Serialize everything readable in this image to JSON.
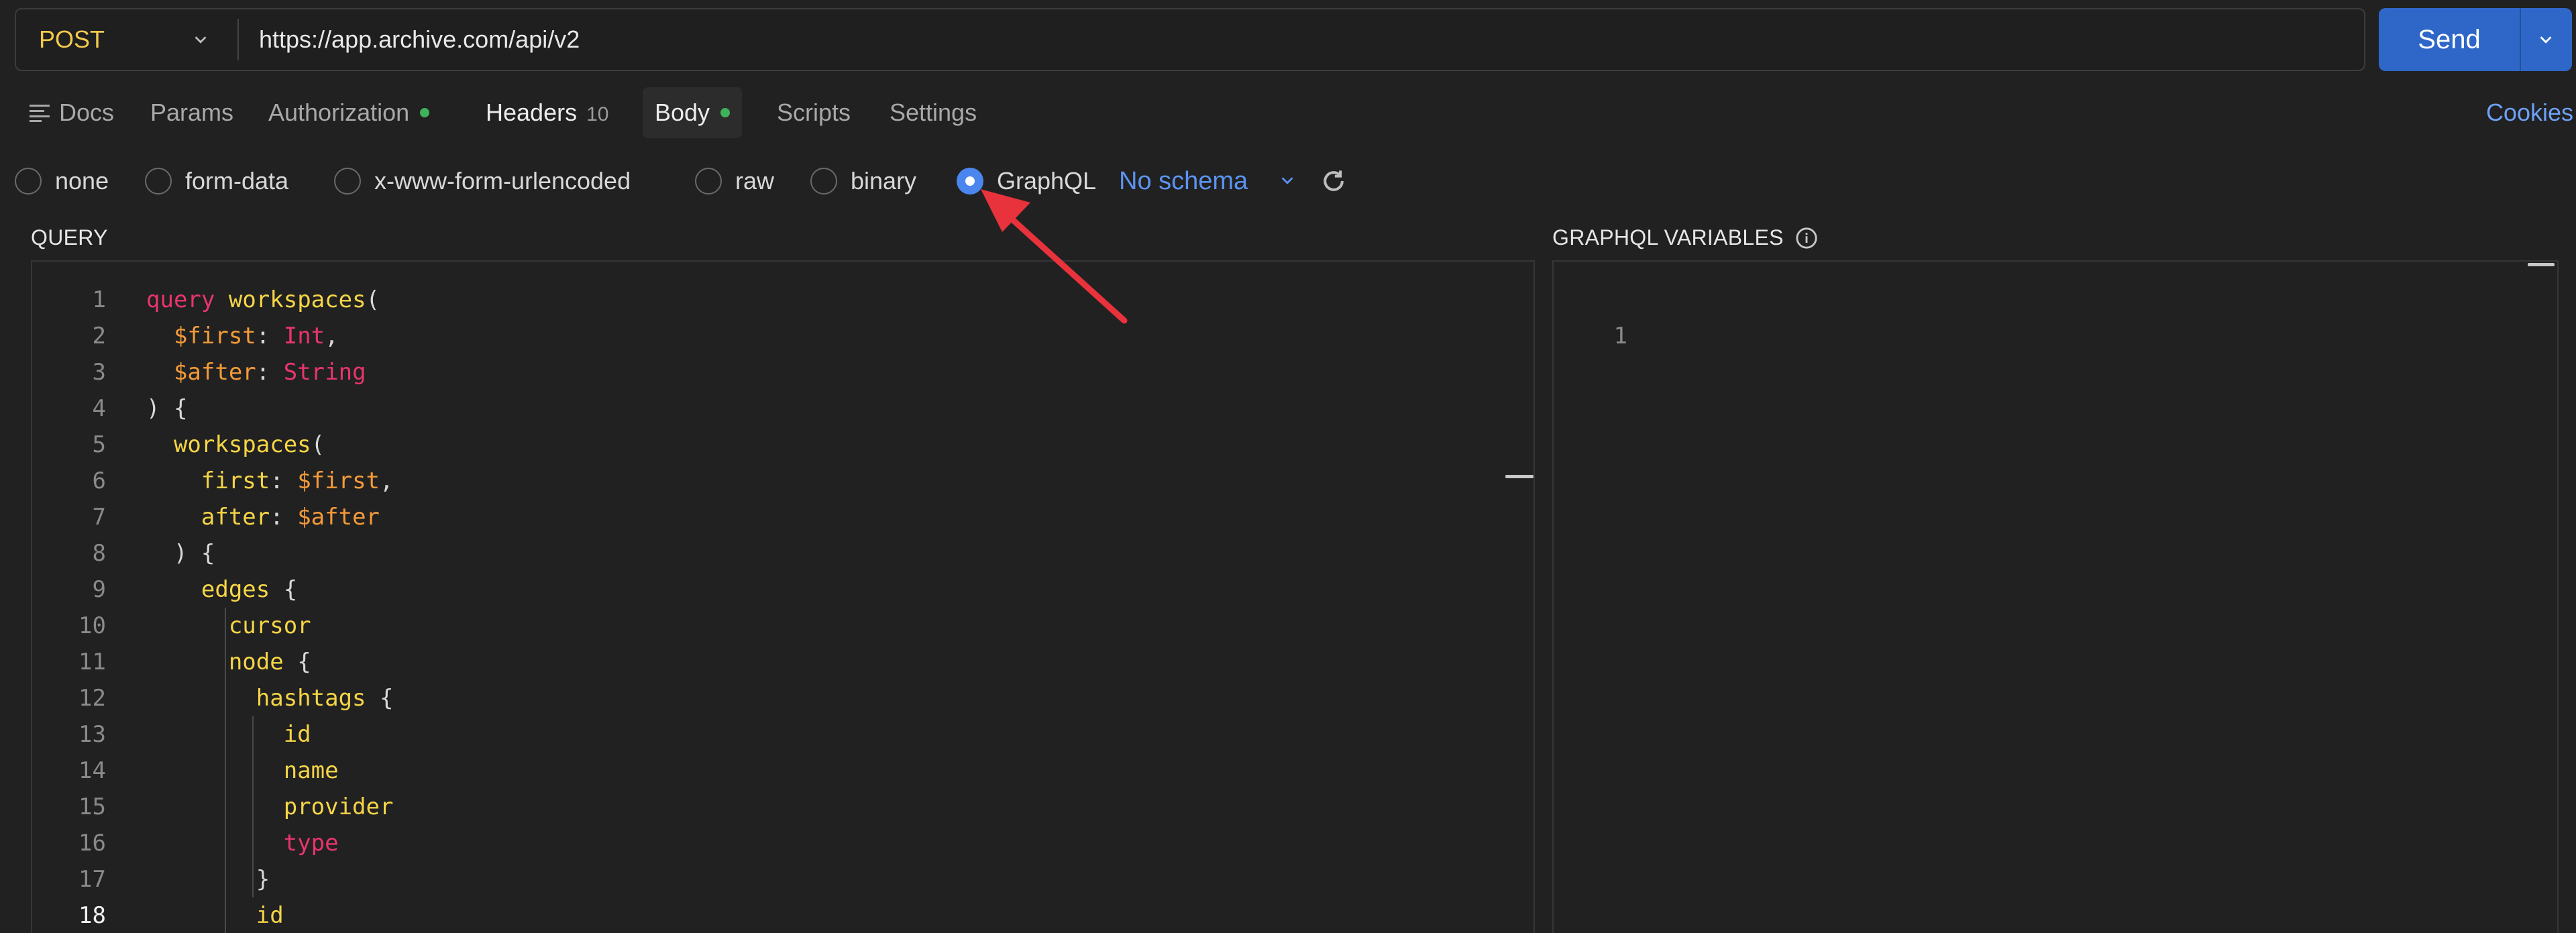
{
  "request": {
    "method": "POST",
    "url": "https://app.archive.com/api/v2",
    "send_label": "Send"
  },
  "tabs": {
    "docs": "Docs",
    "params": "Params",
    "authorization": "Authorization",
    "headers": "Headers",
    "headers_count": "10",
    "body": "Body",
    "scripts": "Scripts",
    "settings": "Settings",
    "cookies": "Cookies",
    "status_dot_color": "#3fb35a"
  },
  "body_types": {
    "options": [
      "none",
      "form-data",
      "x-www-form-urlencoded",
      "raw",
      "binary",
      "GraphQL"
    ],
    "selected": "GraphQL",
    "schema_label": "No schema"
  },
  "query_panel": {
    "title": "QUERY",
    "lines": [
      {
        "n": "1",
        "text": "query workspaces("
      },
      {
        "n": "2",
        "text": "  $first: Int,"
      },
      {
        "n": "3",
        "text": "  $after: String"
      },
      {
        "n": "4",
        "text": ") {"
      },
      {
        "n": "5",
        "text": "  workspaces("
      },
      {
        "n": "6",
        "text": "    first: $first,"
      },
      {
        "n": "7",
        "text": "    after: $after"
      },
      {
        "n": "8",
        "text": "  ) {"
      },
      {
        "n": "9",
        "text": "    edges {"
      },
      {
        "n": "10",
        "text": "      cursor"
      },
      {
        "n": "11",
        "text": "      node {"
      },
      {
        "n": "12",
        "text": "        hashtags {"
      },
      {
        "n": "13",
        "text": "          id"
      },
      {
        "n": "14",
        "text": "          name"
      },
      {
        "n": "15",
        "text": "          provider"
      },
      {
        "n": "16",
        "text": "          type"
      },
      {
        "n": "17",
        "text": "        }"
      },
      {
        "n": "18",
        "text": "        id"
      }
    ],
    "current_line": "18"
  },
  "variables_panel": {
    "title": "GRAPHQL VARIABLES",
    "lines": [
      {
        "n": "1",
        "text": ""
      }
    ]
  },
  "colors": {
    "accent": "#2f67c9",
    "keyword": "#e8356d",
    "field": "#f5d547",
    "variable": "#f39a3a",
    "annotation_arrow": "#e8323c"
  }
}
